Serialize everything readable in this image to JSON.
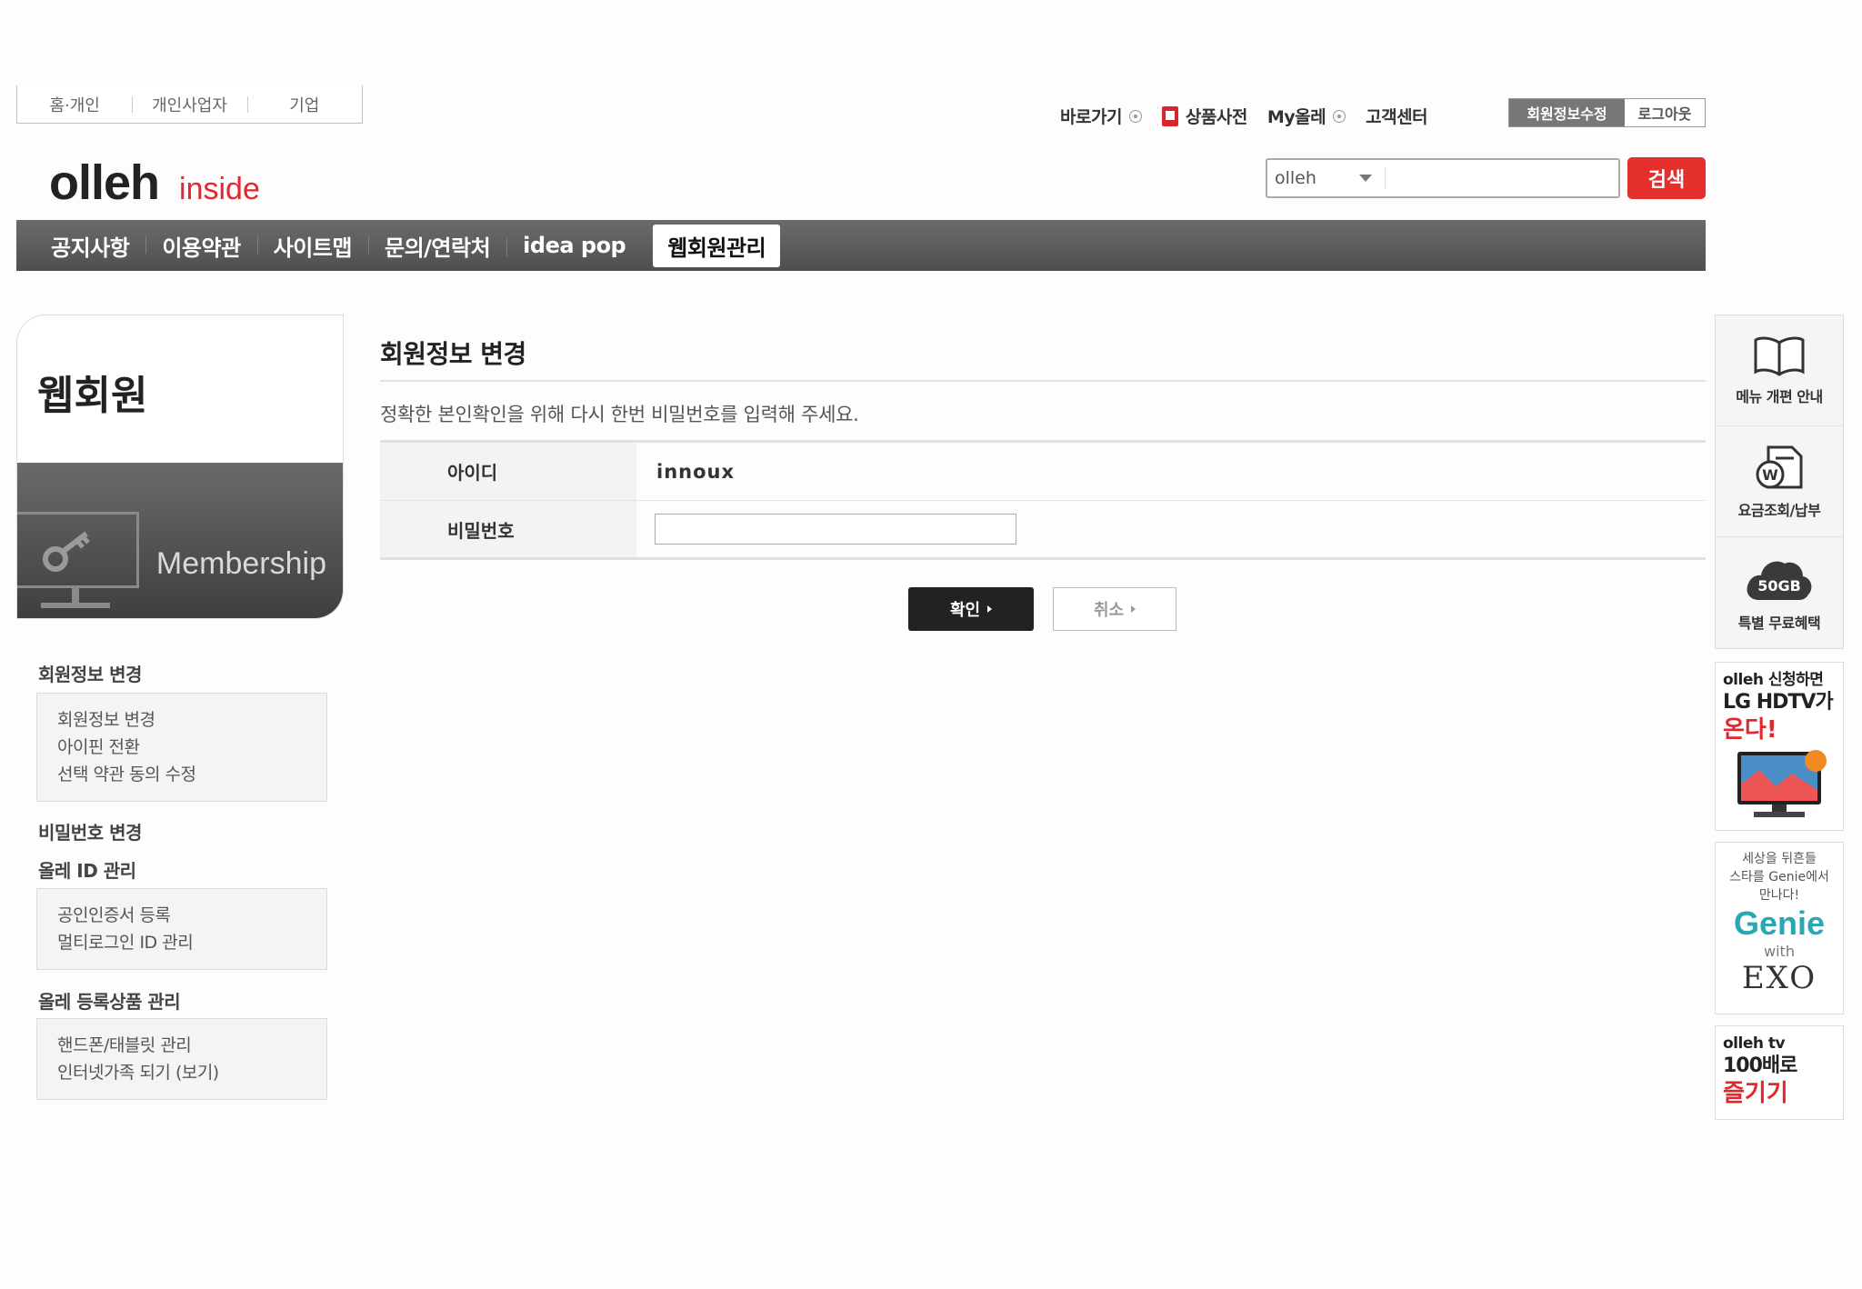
{
  "top_tabs": [
    "홈·개인",
    "개인사업자",
    "기업"
  ],
  "utility": {
    "shortcut": "바로가기",
    "dictionary": "상품사전",
    "my_olleh": "My올레",
    "customer_center": "고객센터",
    "edit_member": "회원정보수정",
    "logout": "로그아웃"
  },
  "logo": {
    "brand": "olleh",
    "sub": "inside"
  },
  "search": {
    "category": "olleh",
    "button": "검색"
  },
  "gnb": [
    "공지사항",
    "이용약관",
    "사이트맵",
    "문의/연락처",
    "idea pop",
    "웹회원관리"
  ],
  "sidebar": {
    "title": "웹회원",
    "badge": "Membership",
    "sections": [
      {
        "heading": "회원정보 변경",
        "items": [
          "회원정보 변경",
          "아이핀 전환",
          "선택 약관 동의 수정"
        ]
      },
      {
        "heading": "비밀번호 변경",
        "items": []
      },
      {
        "heading": "올레 ID 관리",
        "items": [
          "공인인증서 등록",
          "멀티로그인 ID 관리"
        ]
      },
      {
        "heading": "올레 등록상품 관리",
        "items": [
          "핸드폰/태블릿 관리",
          "인터넷가족 되기 (보기)"
        ]
      }
    ]
  },
  "main": {
    "title": "회원정보 변경",
    "description": "정확한 본인확인을 위해 다시 한번 비밀번호를 입력해 주세요.",
    "id_label": "아이디",
    "id_value": "innoux",
    "pw_label": "비밀번호",
    "ok": "확인",
    "cancel": "취소"
  },
  "right": {
    "menu_guide": "메뉴 개편 안내",
    "billing": "요금조회/납부",
    "cloud_label": "50GB",
    "free_benefit": "특별 무료혜택",
    "banner1": {
      "line1": "olleh 신청하면",
      "line2": "LG HDTV가",
      "line3": "온다!"
    },
    "banner2": {
      "line1": "세상을 뒤흔들",
      "line2": "스타를 Genie에서",
      "line3": "만나다!",
      "brand": "Genie",
      "with": "with",
      "artist": "EXO"
    },
    "banner3": {
      "line1": "olleh tv",
      "line2": "100배로",
      "line3": "즐기기"
    }
  }
}
